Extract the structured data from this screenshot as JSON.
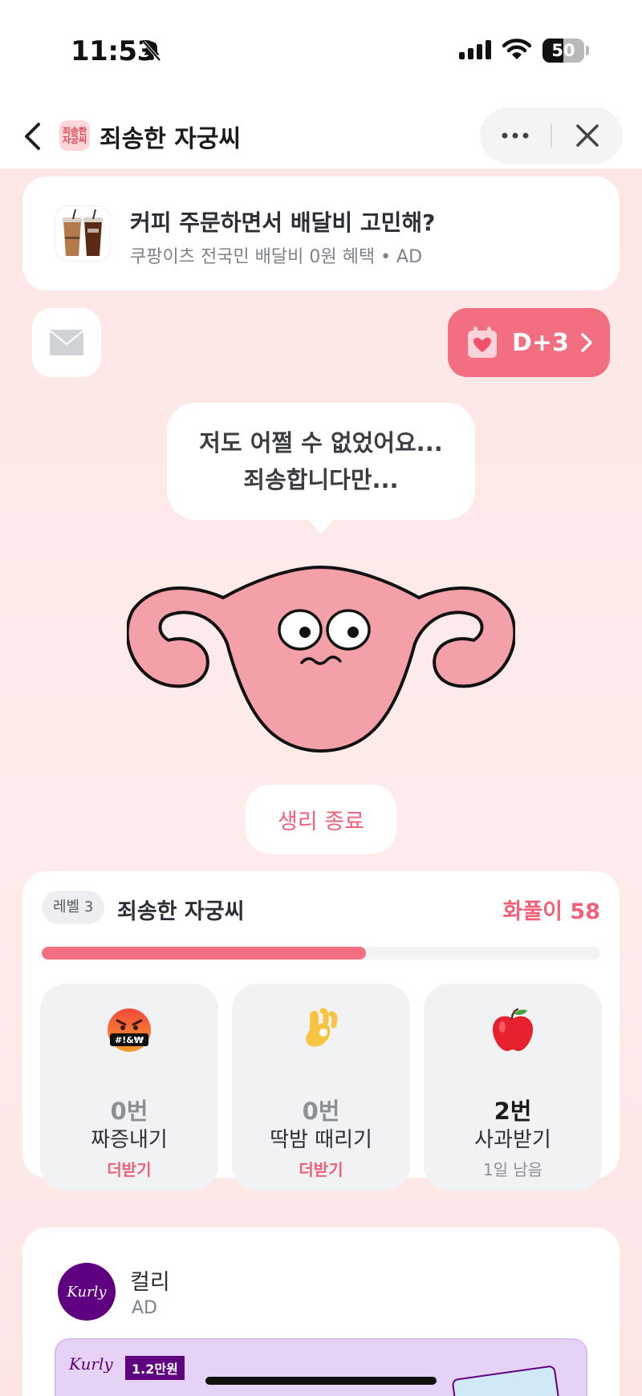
{
  "status_bar": {
    "time": "11:53",
    "battery": "50",
    "battery_level": 0.5
  },
  "nav": {
    "title": "죄송한 자궁씨",
    "app_icon_text": "죄송한\n자궁씨"
  },
  "ad": {
    "title": "커피 주문하면서 배달비 고민해?",
    "subtitle": "쿠팡이츠 전국민 배달비 0원 혜택 • AD"
  },
  "dday": {
    "label": "D+3"
  },
  "speech": {
    "line1": "저도 어쩔 수 없었어요...",
    "line2": "죄송합니다만..."
  },
  "end_button": "생리 종료",
  "level": {
    "badge": "레벨 3",
    "name": "죄송한 자궁씨",
    "score": "화풀이 58",
    "progress": 0.58
  },
  "tiles": [
    {
      "count": "0번",
      "name": "짜증내기",
      "sub": "더받기",
      "icon": "angry-face-icon"
    },
    {
      "count": "0번",
      "name": "딱밤 때리기",
      "sub": "더받기",
      "icon": "ok-hand-icon"
    },
    {
      "count": "2번",
      "name": "사과받기",
      "sub": "1일 남음",
      "icon": "apple-icon"
    }
  ],
  "kurly": {
    "logo": "Kurly",
    "name": "컬리",
    "ad": "AD",
    "banner_brand": "Kurly",
    "banner_price": "1.2만원"
  },
  "colors": {
    "accent": "#f46e82",
    "accent_text": "#f25f78",
    "background": "#fde8e8",
    "mascot": "#f4a0a9"
  }
}
